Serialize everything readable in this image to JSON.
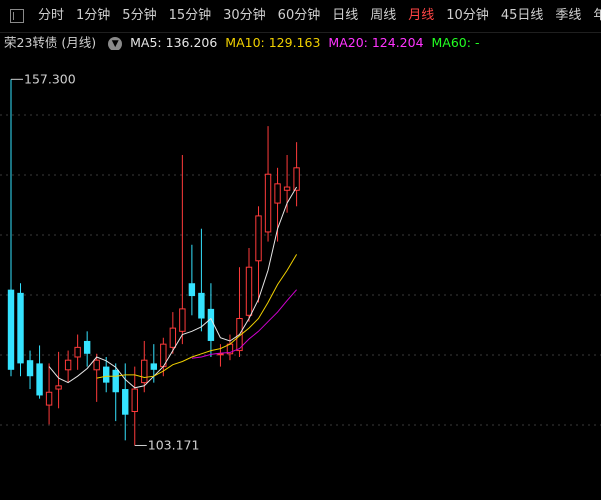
{
  "tabs": [
    "分时",
    "1分钟",
    "5分钟",
    "15分钟",
    "30分钟",
    "60分钟",
    "日线",
    "周线",
    "月线",
    "10分钟",
    "45日线",
    "季线",
    "年线"
  ],
  "active_tab": "月线",
  "security": {
    "name": "荣23转债",
    "period": "(月线)"
  },
  "ma": {
    "ma5": {
      "label": "MA5: 136.206"
    },
    "ma10": {
      "label": "MA10: 129.163"
    },
    "ma20": {
      "label": "MA20: 124.204"
    },
    "ma60": {
      "label": "MA60: -"
    }
  },
  "colors": {
    "up": "#ff3b3b",
    "down": "#35e3ff",
    "ma5": "#e6e6e6",
    "ma10": "#f0d000",
    "ma20": "#d000d0",
    "ma60": "#22ff22"
  },
  "chart_data": {
    "type": "candlestick",
    "title": "荣23转债 (月线)",
    "ylim": [
      97,
      160
    ],
    "annotations": {
      "high_label": "157.300",
      "high": 157.3,
      "low_label": "103.171",
      "low": 103.171
    },
    "candles": [
      {
        "o": 124.5,
        "c": 112.0,
        "h": 157.3,
        "l": 111.0
      },
      {
        "o": 124.0,
        "c": 113.0,
        "h": 125.5,
        "l": 111.0
      },
      {
        "o": 113.5,
        "c": 111.0,
        "h": 115.0,
        "l": 109.0
      },
      {
        "o": 113.0,
        "c": 108.0,
        "h": 115.8,
        "l": 107.5
      },
      {
        "o": 106.5,
        "c": 108.5,
        "h": 113.0,
        "l": 103.5
      },
      {
        "o": 109.0,
        "c": 109.5,
        "h": 114.8,
        "l": 106.0
      },
      {
        "o": 112.0,
        "c": 113.5,
        "h": 115.0,
        "l": 110.0
      },
      {
        "o": 114.0,
        "c": 115.5,
        "h": 117.5,
        "l": 112.0
      },
      {
        "o": 116.5,
        "c": 114.5,
        "h": 118.0,
        "l": 112.5
      },
      {
        "o": 112.0,
        "c": 113.5,
        "h": 114.5,
        "l": 107.0
      },
      {
        "o": 112.5,
        "c": 110.0,
        "h": 114.0,
        "l": 108.5
      },
      {
        "o": 112.0,
        "c": 108.5,
        "h": 113.0,
        "l": 104.0
      },
      {
        "o": 109.0,
        "c": 105.0,
        "h": 113.0,
        "l": 101.0
      },
      {
        "o": 105.5,
        "c": 109.0,
        "h": 112.5,
        "l": 100.2
      },
      {
        "o": 110.0,
        "c": 113.5,
        "h": 116.5,
        "l": 108.5
      },
      {
        "o": 113.0,
        "c": 112.0,
        "h": 116.0,
        "l": 110.0
      },
      {
        "o": 112.5,
        "c": 116.0,
        "h": 117.0,
        "l": 111.0
      },
      {
        "o": 115.5,
        "c": 118.5,
        "h": 121.0,
        "l": 114.5
      },
      {
        "o": 118.0,
        "c": 121.5,
        "h": 145.5,
        "l": 116.0
      },
      {
        "o": 125.5,
        "c": 123.5,
        "h": 131.5,
        "l": 120.5
      },
      {
        "o": 124.0,
        "c": 120.0,
        "h": 134.0,
        "l": 118.0
      },
      {
        "o": 121.5,
        "c": 116.5,
        "h": 125.5,
        "l": 114.0
      },
      {
        "o": 114.5,
        "c": 114.5,
        "h": 116.0,
        "l": 112.5
      },
      {
        "o": 114.5,
        "c": 116.0,
        "h": 117.5,
        "l": 113.5
      },
      {
        "o": 115.0,
        "c": 120.0,
        "h": 128.0,
        "l": 114.0
      },
      {
        "o": 120.5,
        "c": 128.0,
        "h": 131.0,
        "l": 119.5
      },
      {
        "o": 129.0,
        "c": 136.0,
        "h": 137.5,
        "l": 122.5
      },
      {
        "o": 133.5,
        "c": 142.5,
        "h": 150.0,
        "l": 132.0
      },
      {
        "o": 138.0,
        "c": 141.0,
        "h": 143.5,
        "l": 132.0
      },
      {
        "o": 140.0,
        "c": 140.5,
        "h": 145.5,
        "l": 136.5
      },
      {
        "o": 140.0,
        "c": 143.5,
        "h": 147.5,
        "l": 137.5
      }
    ],
    "ma5": [
      null,
      null,
      null,
      null,
      112.5,
      110.7,
      110.0,
      111.0,
      112.2,
      114.0,
      113.4,
      112.4,
      110.5,
      109.2,
      109.5,
      111.0,
      112.5,
      115.0,
      117.5,
      118.0,
      118.7,
      120.0,
      117.0,
      116.5,
      117.5,
      120.0,
      123.0,
      127.5,
      134.0,
      138.0,
      140.5
    ],
    "ma10": [
      null,
      null,
      null,
      null,
      null,
      null,
      null,
      null,
      null,
      110.7,
      111.0,
      111.0,
      111.2,
      111.2,
      110.8,
      111.0,
      111.8,
      112.8,
      113.3,
      114.0,
      114.5,
      115.0,
      115.3,
      116.0,
      117.3,
      118.5,
      120.0,
      122.5,
      125.3,
      127.5,
      130.0
    ],
    "ma20": [
      null,
      null,
      null,
      null,
      null,
      null,
      null,
      null,
      null,
      null,
      null,
      null,
      null,
      null,
      null,
      null,
      null,
      null,
      null,
      113.8,
      114.0,
      114.4,
      114.6,
      114.7,
      115.3,
      116.8,
      118.0,
      119.5,
      121.0,
      122.8,
      124.5
    ]
  }
}
